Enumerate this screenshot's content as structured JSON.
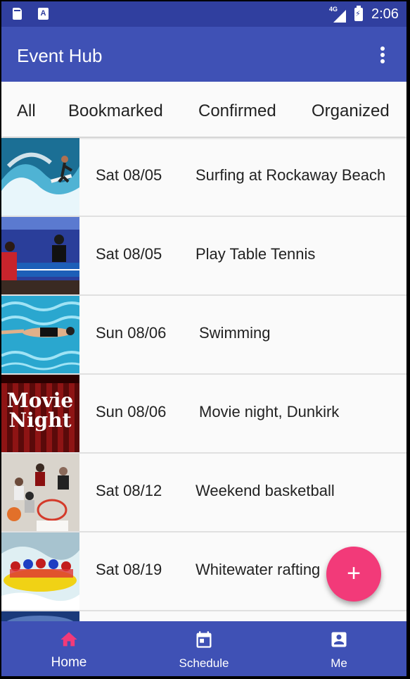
{
  "status_bar": {
    "network": "4G",
    "time": "2:06",
    "sim_icon": "sd-card-icon",
    "notification_icon": "a-notification-icon"
  },
  "app_bar": {
    "title": "Event Hub",
    "menu_icon": "more-vert-icon"
  },
  "tabs": [
    {
      "label": "All"
    },
    {
      "label": "Bookmarked"
    },
    {
      "label": "Confirmed"
    },
    {
      "label": "Organized"
    }
  ],
  "events": [
    {
      "date": "Sat 08/05",
      "name": "Surfing at Rockaway Beach",
      "image": "surfing-photo"
    },
    {
      "date": "Sat 08/05",
      "name": "Play Table Tennis",
      "image": "table-tennis-photo"
    },
    {
      "date": "Sun 08/06",
      "name": "Swimming",
      "image": "swimming-photo"
    },
    {
      "date": "Sun 08/06",
      "name": "Movie night, Dunkirk",
      "image": "movie-night-poster",
      "poster_text": "Movie Night"
    },
    {
      "date": "Sat 08/12",
      "name": "Weekend basketball",
      "image": "basketball-photo"
    },
    {
      "date": "Sat 08/19",
      "name": "Whitewater rafting",
      "image": "rafting-photo"
    }
  ],
  "fab": {
    "label": "+"
  },
  "bottom_nav": [
    {
      "label": "Home",
      "icon": "home-icon",
      "active": true
    },
    {
      "label": "Schedule",
      "icon": "calendar-icon",
      "active": false
    },
    {
      "label": "Me",
      "icon": "account-box-icon",
      "active": false
    }
  ],
  "colors": {
    "primary": "#3f51b5",
    "primary_dark": "#303f9f",
    "accent": "#f23a79"
  }
}
